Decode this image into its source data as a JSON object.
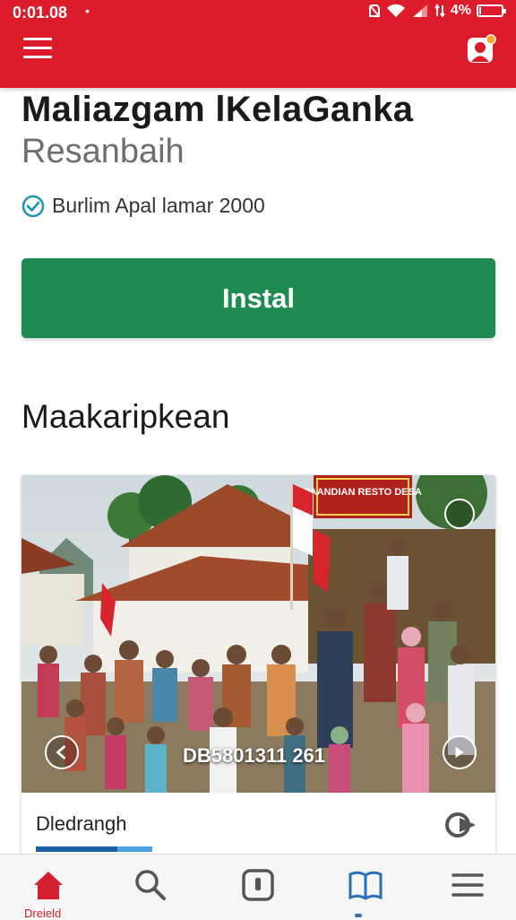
{
  "status_bar": {
    "time": "0:01.08",
    "dot": "•",
    "battery": "4%",
    "battery_level": 0.04
  },
  "app": {
    "title": "Maliazgam lKelaGanka",
    "subtitle": "Resanbaih",
    "verified_text": "Burlim Apal lamar 2000",
    "install_label": "Instal"
  },
  "section": {
    "title": "Maakaripkean"
  },
  "card": {
    "photo_caption": "DB5801311 261",
    "banner_text": "PAANDIAN RESTO DESA",
    "footer_text": "Dledrangh"
  },
  "bottom_nav": {
    "home_label": "Dreield",
    "items": [
      "home-icon",
      "search-icon",
      "apps-icon",
      "book-icon",
      "menu-icon"
    ]
  },
  "colors": {
    "primary": "#dc1b2b",
    "install": "#1e8b50",
    "accent_blue": "#2a6fb8"
  }
}
